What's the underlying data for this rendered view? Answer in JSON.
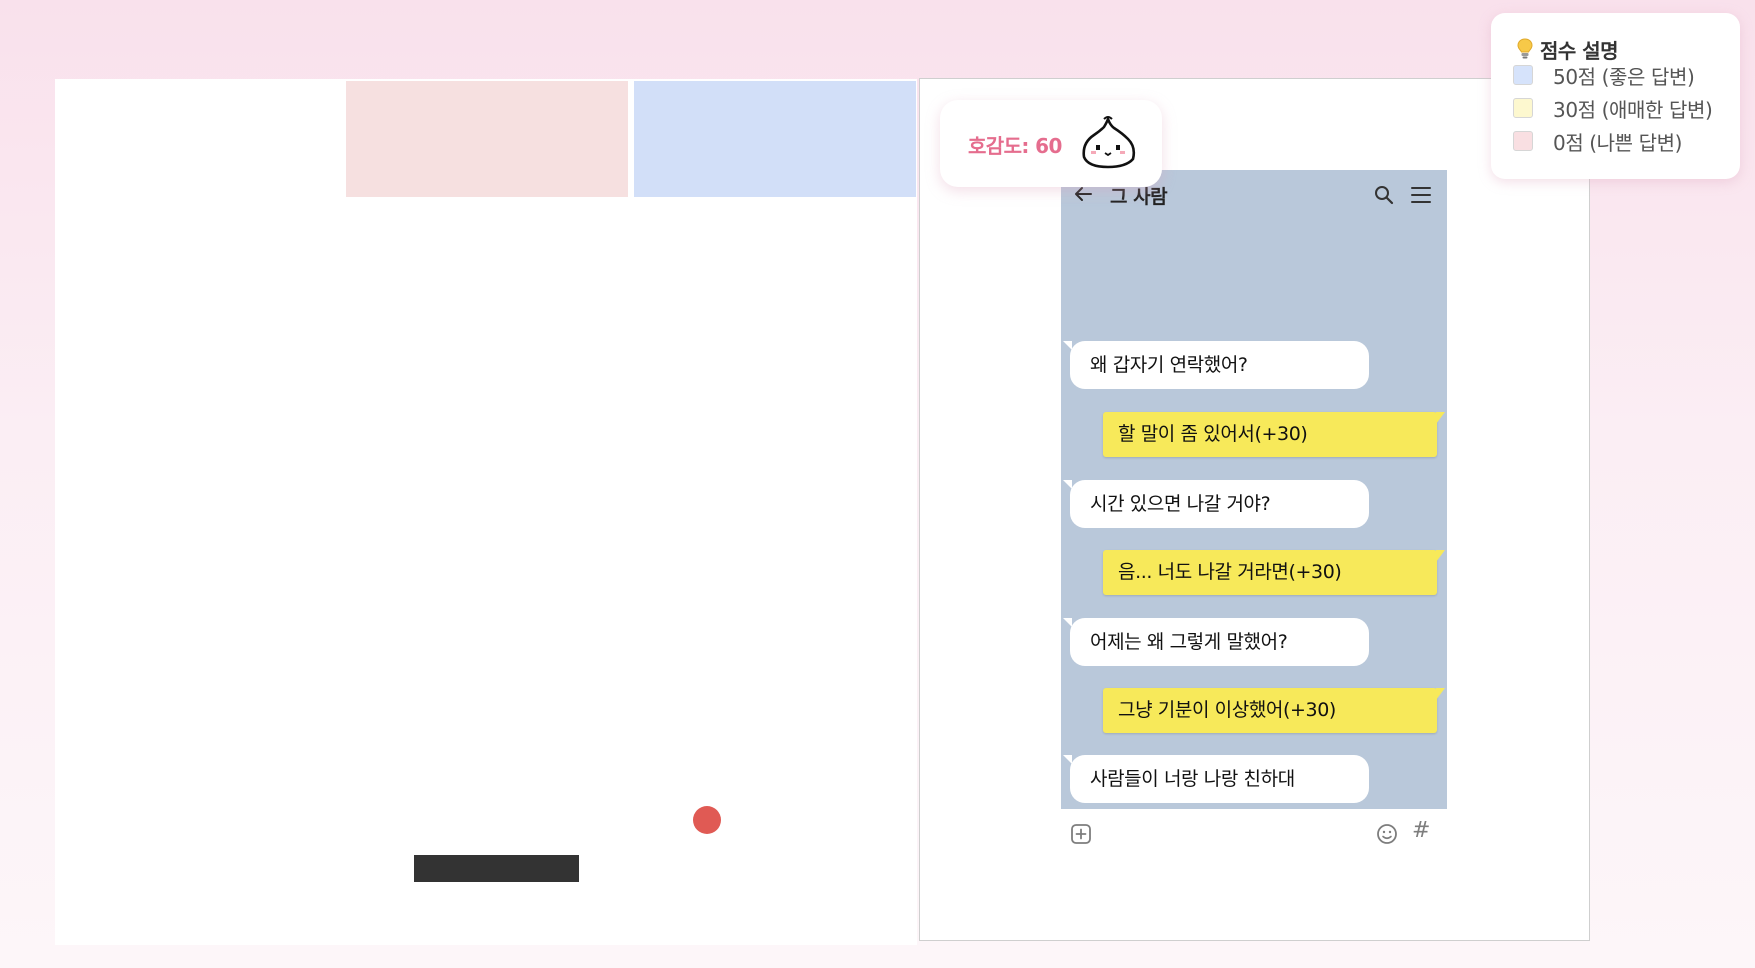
{
  "game": {
    "bricks": [
      {
        "id": "pink",
        "color": "#f6e0e0"
      },
      {
        "id": "blue",
        "color": "#d2dff8"
      }
    ],
    "paddle_color": "#333333",
    "ball_color": "#e05a54"
  },
  "affinity": {
    "text": "호감도: 60",
    "mascot_icon": "dumpling-mascot-icon"
  },
  "chat": {
    "title": "그 사람",
    "header_icons": [
      "back-arrow-icon",
      "search-icon",
      "menu-icon"
    ],
    "messages": [
      {
        "from": "them",
        "text": "왜 갑자기 연락했어?"
      },
      {
        "from": "me",
        "text": "할 말이 좀 있어서(+30)"
      },
      {
        "from": "them",
        "text": "시간 있으면 나갈 거야?"
      },
      {
        "from": "me",
        "text": "음... 너도 나갈 거라면(+30)"
      },
      {
        "from": "them",
        "text": "어제는 왜 그렇게 말했어?"
      },
      {
        "from": "me",
        "text": "그냥 기분이 이상했어(+30)"
      },
      {
        "from": "them",
        "text": "사람들이 너랑 나랑 친하대"
      }
    ],
    "composer_icons": [
      "add-icon",
      "emoji-icon",
      "hash-icon"
    ],
    "hash_symbol": "#"
  },
  "legend": {
    "title": "점수 설명",
    "icon": "lightbulb-icon",
    "items": [
      {
        "label": "50점 (좋은 답변)",
        "color": "#d6e3fb"
      },
      {
        "label": "30점 (애매한 답변)",
        "color": "#fdf8cf"
      },
      {
        "label": "0점 (나쁜 답변)",
        "color": "#f9dfe2"
      }
    ]
  }
}
